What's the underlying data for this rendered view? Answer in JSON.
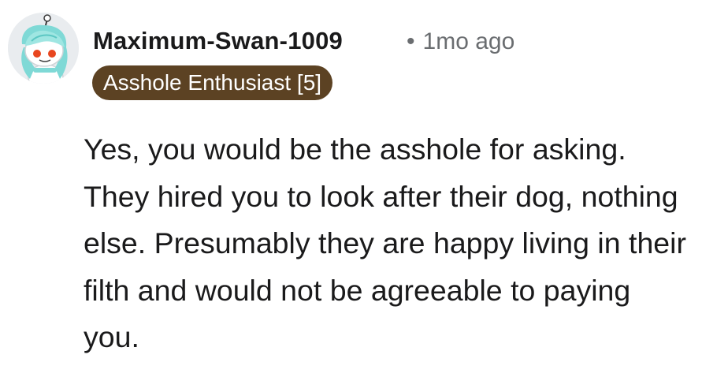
{
  "comment": {
    "author": "Maximum-Swan-1009",
    "separator": "•",
    "timestamp": "1mo ago",
    "flair": "Asshole Enthusiast [5]",
    "body": "Yes, you would be the asshole for asking. They hired you to look after their dog, nothing else. Presumably they are happy living in their filth and would not be agreeable to paying you."
  },
  "avatar": {
    "icon": "reddit-snoo-avatar-icon"
  },
  "colors": {
    "flair_background": "#5c4223",
    "flair_text": "#ffffff",
    "username": "#1a1a1b",
    "meta": "#6a6d70",
    "avatar_hair": "#7fd9d6",
    "avatar_eye": "#e8461f"
  }
}
